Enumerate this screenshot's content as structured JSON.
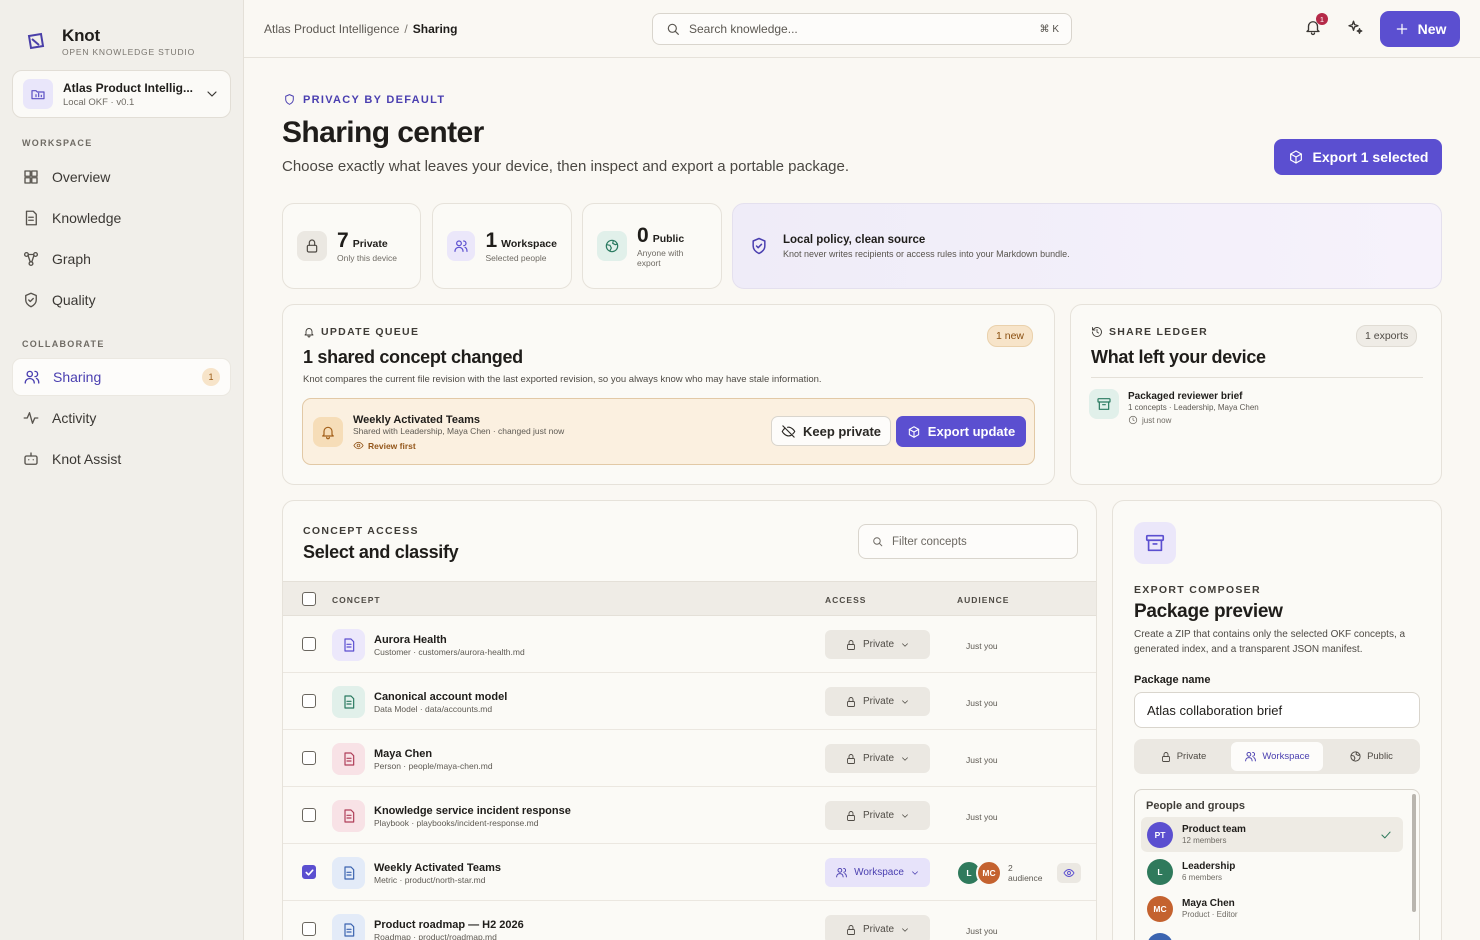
{
  "brand": {
    "name": "Knot",
    "tagline": "OPEN KNOWLEDGE STUDIO"
  },
  "workspace": {
    "name": "Atlas Product Intellig...",
    "version": "Local OKF · v0.1"
  },
  "nav": {
    "workspace_label": "WORKSPACE",
    "collaborate_label": "COLLABORATE",
    "items": [
      {
        "label": "Overview"
      },
      {
        "label": "Knowledge"
      },
      {
        "label": "Graph"
      },
      {
        "label": "Quality"
      },
      {
        "label": "Sharing",
        "badge": "1"
      },
      {
        "label": "Activity"
      },
      {
        "label": "Knot Assist"
      }
    ]
  },
  "topbar": {
    "crumb_root": "Atlas Product Intelligence",
    "crumb_sep": "/",
    "crumb_current": "Sharing",
    "search_placeholder": "Search knowledge...",
    "search_kbd": "⌘ K",
    "notif_count": "1",
    "new_label": "New"
  },
  "header": {
    "kicker": "PRIVACY BY DEFAULT",
    "title": "Sharing center",
    "subtitle": "Choose exactly what leaves your device, then inspect and export a portable package.",
    "export_label": "Export 1 selected"
  },
  "stats": [
    {
      "num": "7",
      "label": "Private",
      "sub": "Only this device"
    },
    {
      "num": "1",
      "label": "Workspace",
      "sub": "Selected people"
    },
    {
      "num": "0",
      "label": "Public",
      "sub1": "Anyone with",
      "sub2": "export"
    }
  ],
  "policy": {
    "title": "Local policy, clean source",
    "text": "Knot never writes recipients or access rules into your Markdown bundle."
  },
  "update_queue": {
    "kicker": "UPDATE QUEUE",
    "badge": "1 new",
    "title": "1 shared concept changed",
    "desc": "Knot compares the current file revision with the last exported revision, so you always know who may have stale information.",
    "item": {
      "name": "Weekly Activated Teams",
      "meta": "Shared with Leadership, Maya Chen · changed just now",
      "review": "Review first",
      "keep_label": "Keep private",
      "export_label": "Export update"
    }
  },
  "ledger": {
    "kicker": "SHARE LEDGER",
    "badge": "1 exports",
    "title": "What left your device",
    "item": {
      "name": "Packaged reviewer brief",
      "meta": "1 concepts · Leadership, Maya Chen",
      "time": "just now"
    }
  },
  "concepts": {
    "kicker": "CONCEPT ACCESS",
    "title": "Select and classify",
    "filter_placeholder": "Filter concepts",
    "columns": {
      "concept": "CONCEPT",
      "access": "ACCESS",
      "audience": "AUDIENCE"
    },
    "rows": [
      {
        "name": "Aurora Health",
        "path": "Customer · customers/aurora-health.md",
        "access": "Private",
        "audience": "Just you",
        "checked": false,
        "tint": "#ece8fb",
        "ink": "#5b4fd0"
      },
      {
        "name": "Canonical account model",
        "path": "Data Model · data/accounts.md",
        "access": "Private",
        "audience": "Just you",
        "checked": false,
        "tint": "#e1f0ea",
        "ink": "#2a7a60"
      },
      {
        "name": "Maya Chen",
        "path": "Person · people/maya-chen.md",
        "access": "Private",
        "audience": "Just you",
        "checked": false,
        "tint": "#f8e2e6",
        "ink": "#b0405a"
      },
      {
        "name": "Knowledge service incident response",
        "path": "Playbook · playbooks/incident-response.md",
        "access": "Private",
        "audience": "Just you",
        "checked": false,
        "tint": "#f8e2e6",
        "ink": "#b0405a"
      },
      {
        "name": "Weekly Activated Teams",
        "path": "Metric · product/north-star.md",
        "access": "Workspace",
        "audience": "2",
        "audience2": "audience",
        "checked": true,
        "tint": "#e3ebf8",
        "ink": "#3b64b0",
        "avatars": [
          {
            "i": "L",
            "c": "#2f7a5c"
          },
          {
            "i": "MC",
            "c": "#c4622f"
          }
        ]
      },
      {
        "name": "Product roadmap — H2 2026",
        "path": "Roadmap · product/roadmap.md",
        "access": "Private",
        "audience": "Just you",
        "checked": false,
        "tint": "#e3ebf8",
        "ink": "#3b64b0"
      }
    ]
  },
  "composer": {
    "kicker": "EXPORT COMPOSER",
    "title": "Package preview",
    "desc": "Create a ZIP that contains only the selected OKF concepts, a generated index, and a transparent JSON manifest.",
    "name_label": "Package name",
    "name_value": "Atlas collaboration brief",
    "segments": [
      "Private",
      "Workspace",
      "Public"
    ],
    "people_header": "People and groups",
    "people": [
      {
        "initials": "PT",
        "name": "Product team",
        "sub": "12 members",
        "color": "#5b4fd0",
        "selected": true
      },
      {
        "initials": "L",
        "name": "Leadership",
        "sub": "6 members",
        "color": "#2f7a5c"
      },
      {
        "initials": "MC",
        "name": "Maya Chen",
        "sub": "Product · Editor",
        "color": "#c4622f"
      },
      {
        "initials": "",
        "name": "",
        "sub": "",
        "color": "#3b64b0"
      }
    ]
  },
  "colors": {
    "accent": "#5b4fd0",
    "warning": "#fbf0e0",
    "danger": "#b52a48"
  }
}
